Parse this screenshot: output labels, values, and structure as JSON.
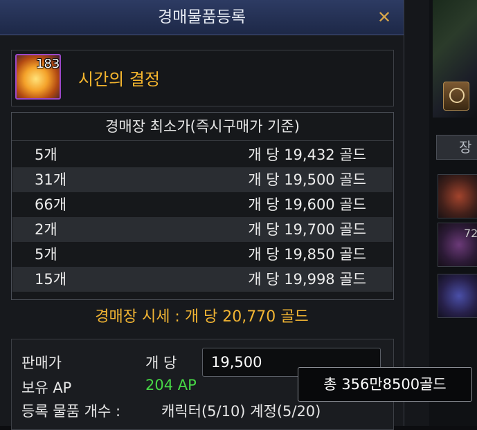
{
  "dialog": {
    "title": "경매물품등록",
    "close_glyph": "✕"
  },
  "item": {
    "count": "183",
    "name": "시간의 결정",
    "icon": "time-crystal-icon"
  },
  "price_table": {
    "header": "경매장 최소가(즉시구매가 기준)",
    "rows": [
      {
        "qty": "5개",
        "price": "개 당 19,432 골드"
      },
      {
        "qty": "31개",
        "price": "개 당 19,500 골드"
      },
      {
        "qty": "66개",
        "price": "개 당 19,600 골드"
      },
      {
        "qty": "2개",
        "price": "개 당 19,700 골드"
      },
      {
        "qty": "5개",
        "price": "개 당 19,850 골드"
      },
      {
        "qty": "15개",
        "price": "개 당 19,998 골드"
      }
    ]
  },
  "market_price": "경매장 시세 : 개 당 20,770 골드",
  "form": {
    "sell_price_label": "판매가",
    "per_unit_label": "개 당",
    "sell_price_value": "19,500",
    "ap_label": "보유 AP",
    "ap_value": "204 AP",
    "count_label": "등록 물품 개수 :",
    "count_value": "캐릭터(5/10) 계정(5/20)"
  },
  "tooltip": "총 356만8500골드",
  "background": {
    "tab_label": "장",
    "badge": "72"
  },
  "colors": {
    "accent_gold": "#f2b533",
    "ap_green": "#47d846",
    "title_bar": "#2d3b63"
  }
}
